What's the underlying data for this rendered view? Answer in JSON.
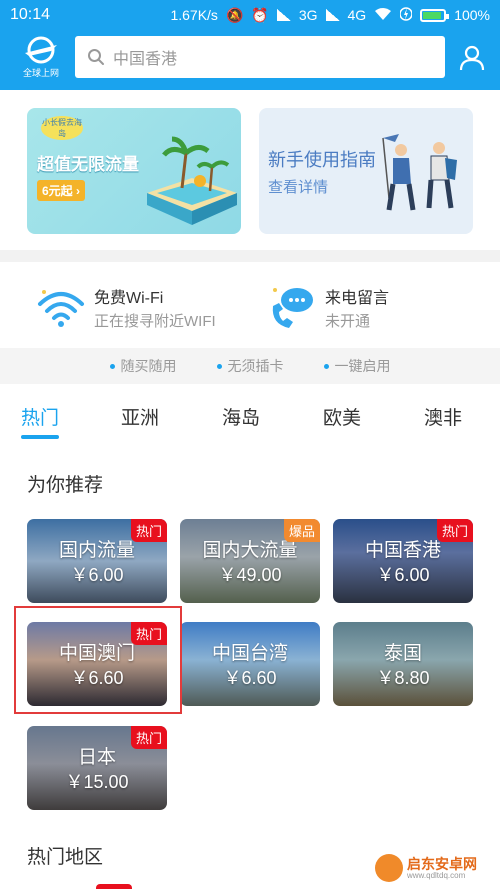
{
  "status_bar": {
    "time": "10:14",
    "speed": "1.67K/s",
    "network": "3G",
    "network2": "4G",
    "battery": "100%"
  },
  "header": {
    "logo_text": "全球上网",
    "search_placeholder": "中国香港",
    "icons": [
      "airplane-logo-icon",
      "search-icon",
      "user-icon"
    ]
  },
  "banners": {
    "left": {
      "tag": "小长假去海岛",
      "title": "超值无限流量",
      "sub": "6元起 ›"
    },
    "right": {
      "title": "新手使用指南",
      "sub": "查看详情"
    }
  },
  "features": {
    "wifi": {
      "title": "免费Wi-Fi",
      "sub": "正在搜寻附近WIFI"
    },
    "voicemail": {
      "title": "来电留言",
      "sub": "未开通"
    }
  },
  "benefits": [
    "随买随用",
    "无须插卡",
    "一键启用"
  ],
  "tabs": [
    "热门",
    "亚洲",
    "海岛",
    "欧美",
    "澳非"
  ],
  "active_tab": "热门",
  "recommend": {
    "title": "为你推荐",
    "cards": [
      {
        "name": "国内流量",
        "price": "￥6.00",
        "badge": "热门"
      },
      {
        "name": "国内大流量",
        "price": "￥49.00",
        "badge": "爆品"
      },
      {
        "name": "中国香港",
        "price": "￥6.00",
        "badge": "热门"
      },
      {
        "name": "中国澳门",
        "price": "￥6.60",
        "badge": "热门"
      },
      {
        "name": "中国台湾",
        "price": "￥6.60",
        "badge": ""
      },
      {
        "name": "泰国",
        "price": "￥8.80",
        "badge": ""
      },
      {
        "name": "日本",
        "price": "￥15.00",
        "badge": "热门"
      }
    ]
  },
  "hot_regions": {
    "title": "热门地区"
  },
  "watermark": {
    "text": "启东安卓网",
    "url": "www.qdltdq.com"
  },
  "colors": {
    "primary": "#1aa3ee",
    "hot_badge": "#e8101e",
    "boom_badge": "#f28a2f",
    "highlight": "#e23b3b"
  }
}
